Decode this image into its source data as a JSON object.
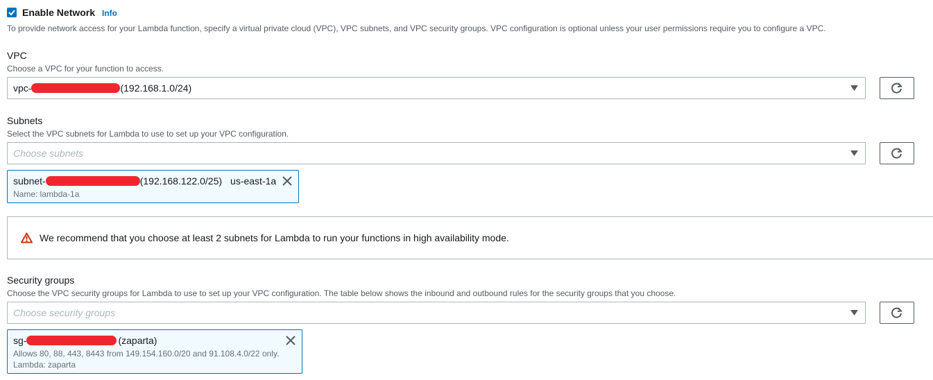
{
  "network": {
    "enable_label": "Enable Network",
    "enabled": true,
    "info_link": "Info",
    "description": "To provide network access for your Lambda function, specify a virtual private cloud (VPC), VPC subnets, and VPC security groups. VPC configuration is optional unless your user permissions require you to configure a VPC."
  },
  "vpc": {
    "label": "VPC",
    "description": "Choose a VPC for your function to access.",
    "value_prefix": "vpc-",
    "value_suffix": "(192.168.1.0/24)"
  },
  "subnets": {
    "label": "Subnets",
    "description": "Select the VPC subnets for Lambda to use to set up your VPC configuration.",
    "placeholder": "Choose subnets",
    "selected": {
      "prefix": "subnet-",
      "cidr": "(192.168.122.0/25)",
      "az": "us-east-1a",
      "name": "Name: lambda-1a"
    }
  },
  "alert": {
    "message": "We recommend that you choose at least 2 subnets for Lambda to run your functions in high availability mode.",
    "icon": "warning-icon",
    "color": "#d13212"
  },
  "security_groups": {
    "label": "Security groups",
    "description": "Choose the VPC security groups for Lambda to use to set up your VPC configuration. The table below shows the inbound and outbound rules for the security groups that you choose.",
    "placeholder": "Choose security groups",
    "selected": {
      "prefix": "sg-",
      "name": "(zaparta)",
      "rules": "Allows 80, 88, 443, 8443 from 149.154.160.0/20 and 91.108.4.0/22 only.",
      "tag": "Lambda: zaparta"
    }
  },
  "colors": {
    "accent": "#0073bb",
    "warning": "#d13212",
    "redaction": "#f0262f"
  }
}
